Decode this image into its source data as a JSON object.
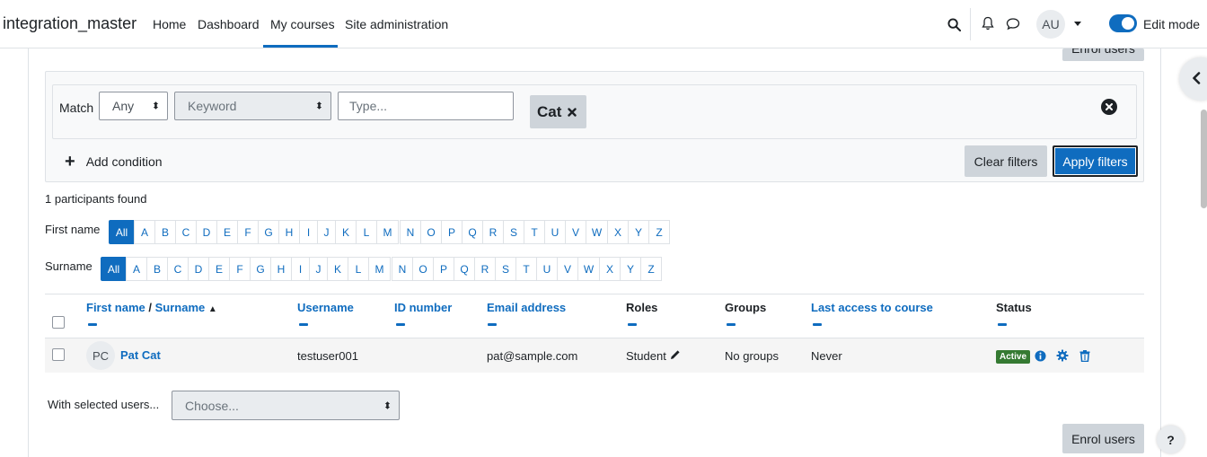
{
  "navbar": {
    "site_name": "integration_master",
    "links": [
      "Home",
      "Dashboard",
      "My courses",
      "Site administration"
    ],
    "avatar_initials": "AU",
    "edit_mode_label": "Edit mode",
    "edit_mode_on": true
  },
  "top_enrol_label": "Enrol users",
  "filters": {
    "match_label": "Match",
    "match_value": "Any",
    "type_value": "Keyword",
    "text_placeholder": "Type...",
    "chip_value": "Cat",
    "add_condition_label": "Add condition",
    "clear_label": "Clear filters",
    "apply_label": "Apply filters"
  },
  "found_text": "1 participants found",
  "initials_bars": {
    "firstname_label": "First name",
    "surname_label": "Surname",
    "all_label": "All",
    "letters": [
      "A",
      "B",
      "C",
      "D",
      "E",
      "F",
      "G",
      "H",
      "I",
      "J",
      "K",
      "L",
      "M",
      "N",
      "O",
      "P",
      "Q",
      "R",
      "S",
      "T",
      "U",
      "V",
      "W",
      "X",
      "Y",
      "Z"
    ]
  },
  "table": {
    "headers": {
      "firstname": "First name",
      "sep": "/",
      "surname": "Surname",
      "username": "Username",
      "idnumber": "ID number",
      "email": "Email address",
      "roles": "Roles",
      "groups": "Groups",
      "lastaccess": "Last access to course",
      "status": "Status"
    },
    "rows": [
      {
        "initials": "PC",
        "name": "Pat Cat",
        "username": "testuser001",
        "idnumber": "",
        "email": "pat@sample.com",
        "role": "Student",
        "groups": "No groups",
        "lastaccess": "Never",
        "status": "Active"
      }
    ]
  },
  "bulk": {
    "label": "With selected users...",
    "select_value": "Choose..."
  },
  "bottom_enrol_label": "Enrol users",
  "help_label": "?",
  "colors": {
    "primary": "#0f6cbf",
    "active_badge": "#357a32",
    "secondary_button": "#ced4da"
  }
}
